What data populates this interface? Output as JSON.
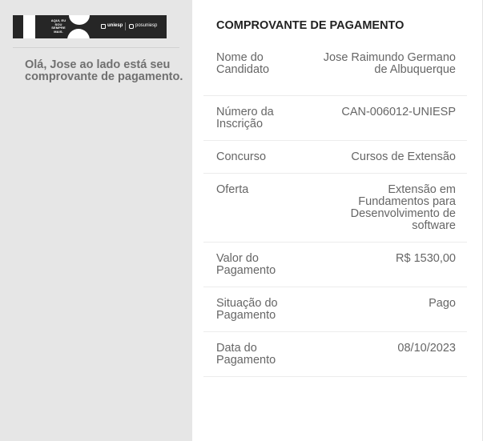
{
  "sidebar": {
    "banner": {
      "tagline": "AQUI, EU SOU SEMPRE MAIS.",
      "brand": "uniesp",
      "social_handle": "posuniesp",
      "colors": {
        "background": "#262626",
        "foreground": "#ffffff"
      }
    },
    "greeting": "Olá, Jose ao lado está seu comprovante de pagamento."
  },
  "receipt": {
    "title": "COMPROVANTE DE PAGAMENTO",
    "rows": [
      {
        "label": "Nome do Candidato",
        "value": "Jose Raimundo Germano de Albuquerque"
      },
      {
        "label": "Número da Inscrição",
        "value": "CAN-006012-UNIESP"
      },
      {
        "label": "Concurso",
        "value": "Cursos de Extensão"
      },
      {
        "label": "Oferta",
        "value": "Extensão em Fundamentos para Desenvolvimento de software"
      },
      {
        "label": "Valor do Pagamento",
        "value": "R$ 1530,00"
      },
      {
        "label": "Situação do Pagamento",
        "value": "Pago"
      },
      {
        "label": "Data do Pagamento",
        "value": "08/10/2023"
      }
    ]
  },
  "colors": {
    "sidebar_bg": "#e6e6e6",
    "text_muted": "#666666",
    "title_text": "#222222"
  }
}
